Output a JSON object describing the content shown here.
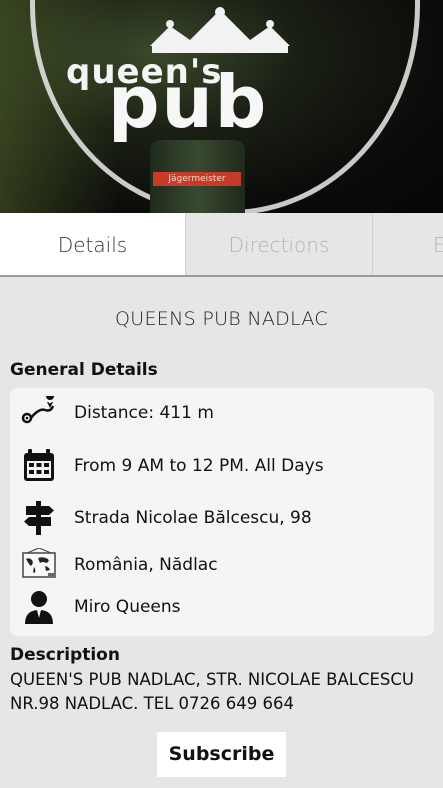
{
  "hero": {
    "logo_line1": "queen's",
    "logo_line2": "pub",
    "bottle_label": "Jägermeister"
  },
  "tabs": [
    {
      "label": "Details",
      "active": true
    },
    {
      "label": "Directions",
      "active": false
    },
    {
      "label": "E",
      "active": false
    }
  ],
  "title": "QUEENS PUB NADLAC",
  "general": {
    "heading": "General Details",
    "rows": [
      {
        "icon": "route-icon",
        "text": "Distance: 411 m"
      },
      {
        "icon": "calendar-icon",
        "text": "From 9 AM to 12 PM. All Days"
      },
      {
        "icon": "signpost-icon",
        "text": "Strada Nicolae Bălcescu, 98"
      },
      {
        "icon": "map-icon",
        "text": "România, Nădlac"
      },
      {
        "icon": "person-icon",
        "text": "Miro Queens"
      }
    ]
  },
  "description": {
    "heading": "Description",
    "text": "QUEEN'S PUB NADLAC, STR. NICOLAE BALCESCU NR.98 NADLAC. TEL 0726 649 664"
  },
  "subscribe_label": "Subscribe",
  "colors": {
    "background": "#e6e6e6",
    "card": "#f5f5f7",
    "active_tab": "#ffffff",
    "inactive_tab_text": "#b4b4b4"
  }
}
